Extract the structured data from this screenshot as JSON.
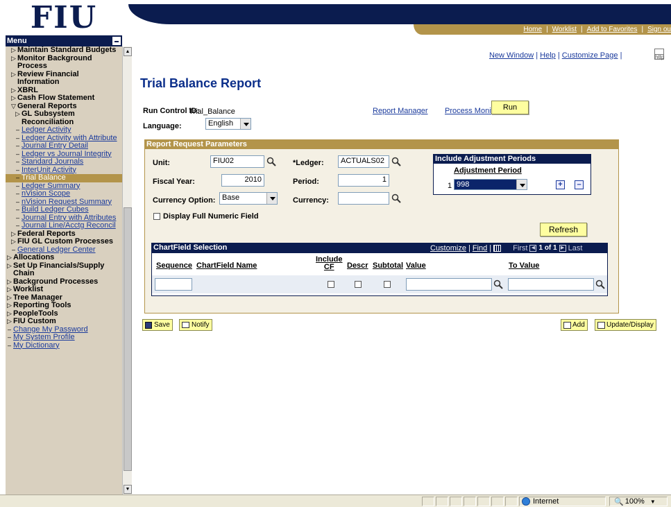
{
  "logo": "FIU",
  "topnav": {
    "home": "Home",
    "worklist": "Worklist",
    "favorites": "Add to Favorites",
    "signout": "Sign ou"
  },
  "menu": {
    "title": "Menu",
    "items": [
      {
        "prefix": "▷",
        "label": "Maintain Standard Budgets",
        "bold": true,
        "indent": 1
      },
      {
        "prefix": "▷",
        "label": "Monitor Background Process",
        "bold": true,
        "indent": 1
      },
      {
        "prefix": "▷",
        "label": "Review Financial Information",
        "bold": true,
        "indent": 1
      },
      {
        "prefix": "▷",
        "label": "XBRL",
        "bold": true,
        "indent": 1
      },
      {
        "prefix": "▷",
        "label": "Cash Flow Statement",
        "bold": true,
        "indent": 1
      },
      {
        "prefix": "▽",
        "label": "General Reports",
        "bold": true,
        "indent": 1
      },
      {
        "prefix": "▷",
        "label": "GL Subsystem Reconciliation",
        "bold": true,
        "indent": 2
      },
      {
        "prefix": "–",
        "label": "Ledger Activity",
        "link": true,
        "indent": 2
      },
      {
        "prefix": "–",
        "label": "Ledger Activity with Attribute",
        "link": true,
        "indent": 2
      },
      {
        "prefix": "–",
        "label": "Journal Entry Detail",
        "link": true,
        "indent": 2
      },
      {
        "prefix": "–",
        "label": "Ledger vs Journal Integrity",
        "link": true,
        "indent": 2
      },
      {
        "prefix": "–",
        "label": "Standard Journals",
        "link": true,
        "indent": 2
      },
      {
        "prefix": "–",
        "label": "InterUnit Activity",
        "link": true,
        "indent": 2
      },
      {
        "prefix": "–",
        "label": "Trial Balance",
        "link": true,
        "selected": true,
        "indent": 2
      },
      {
        "prefix": "–",
        "label": "Ledger Summary",
        "link": true,
        "indent": 2
      },
      {
        "prefix": "–",
        "label": "nVision Scope",
        "link": true,
        "indent": 2
      },
      {
        "prefix": "–",
        "label": "nVision Request Summary",
        "link": true,
        "indent": 2
      },
      {
        "prefix": "–",
        "label": "Build Ledger Cubes",
        "link": true,
        "indent": 2
      },
      {
        "prefix": "–",
        "label": "Journal Entry with Attributes",
        "link": true,
        "indent": 2
      },
      {
        "prefix": "–",
        "label": "Journal Line/Acctg Reconcil",
        "link": true,
        "indent": 2
      },
      {
        "prefix": "▷",
        "label": "Federal Reports",
        "bold": true,
        "indent": 1
      },
      {
        "prefix": "▷",
        "label": "FIU GL Custom Processes",
        "bold": true,
        "indent": 1
      },
      {
        "prefix": "–",
        "label": "General Ledger Center",
        "link": true,
        "indent": 1
      },
      {
        "prefix": "▷",
        "label": "Allocations",
        "bold": true,
        "indent": 0
      },
      {
        "prefix": "▷",
        "label": "Set Up Financials/Supply Chain",
        "bold": true,
        "indent": 0
      },
      {
        "prefix": "▷",
        "label": "Background Processes",
        "bold": true,
        "indent": 0
      },
      {
        "prefix": "▷",
        "label": "Worklist",
        "bold": true,
        "indent": 0
      },
      {
        "prefix": "▷",
        "label": "Tree Manager",
        "bold": true,
        "indent": 0
      },
      {
        "prefix": "▷",
        "label": "Reporting Tools",
        "bold": true,
        "indent": 0
      },
      {
        "prefix": "▷",
        "label": "PeopleTools",
        "bold": true,
        "indent": 0
      },
      {
        "prefix": "▷",
        "label": "FIU Custom",
        "bold": true,
        "indent": 0
      },
      {
        "prefix": "–",
        "label": "Change My Password",
        "link": true,
        "indent": 0
      },
      {
        "prefix": "–",
        "label": "My System Profile",
        "link": true,
        "indent": 0
      },
      {
        "prefix": "–",
        "label": "My Dictionary",
        "link": true,
        "indent": 0
      }
    ]
  },
  "toplinks": {
    "new_window": "New Window",
    "help": "Help",
    "customize": "Customize Page",
    "sep": "|",
    "http": "http"
  },
  "page_title": "Trial Balance Report",
  "run_control": {
    "label": "Run Control ID:",
    "value": "Trial_Balance"
  },
  "language": {
    "label": "Language:",
    "value": "English"
  },
  "report_manager": "Report Manager",
  "process_monitor": "Process Monitor",
  "run_button": "Run",
  "params": {
    "title": "Report Request Parameters",
    "unit_label": "Unit:",
    "unit_value": "FIU02",
    "ledger_label": "*Ledger:",
    "ledger_value": "ACTUALS02",
    "fiscal_year_label": "Fiscal Year:",
    "fiscal_year_value": "2010",
    "period_label": "Period:",
    "period_value": "1",
    "currency_option_label": "Currency Option:",
    "currency_option_value": "Base",
    "currency_label": "Currency:",
    "currency_value": "",
    "display_full_label": "Display Full Numeric Field",
    "refresh_button": "Refresh"
  },
  "adjustment": {
    "title": "Include Adjustment Periods",
    "col": "Adjustment Period",
    "row_num": "1",
    "value": "998"
  },
  "chartfield": {
    "title": "ChartField Selection",
    "customize": "Customize",
    "find": "Find",
    "nav": "First",
    "count": "1 of 1",
    "last": "Last",
    "sep": "|",
    "col_sequence": "Sequence",
    "col_name": "ChartField Name",
    "col_include_1": "Include",
    "col_include_2": "CF",
    "col_descr": "Descr",
    "col_subtotal": "Subtotal",
    "col_value": "Value",
    "col_to_value": "To Value"
  },
  "buttons": {
    "save": "Save",
    "notify": "Notify",
    "add": "Add",
    "update": "Update/Display"
  },
  "statusbar": {
    "zone": "Internet",
    "zoom": "100%"
  }
}
